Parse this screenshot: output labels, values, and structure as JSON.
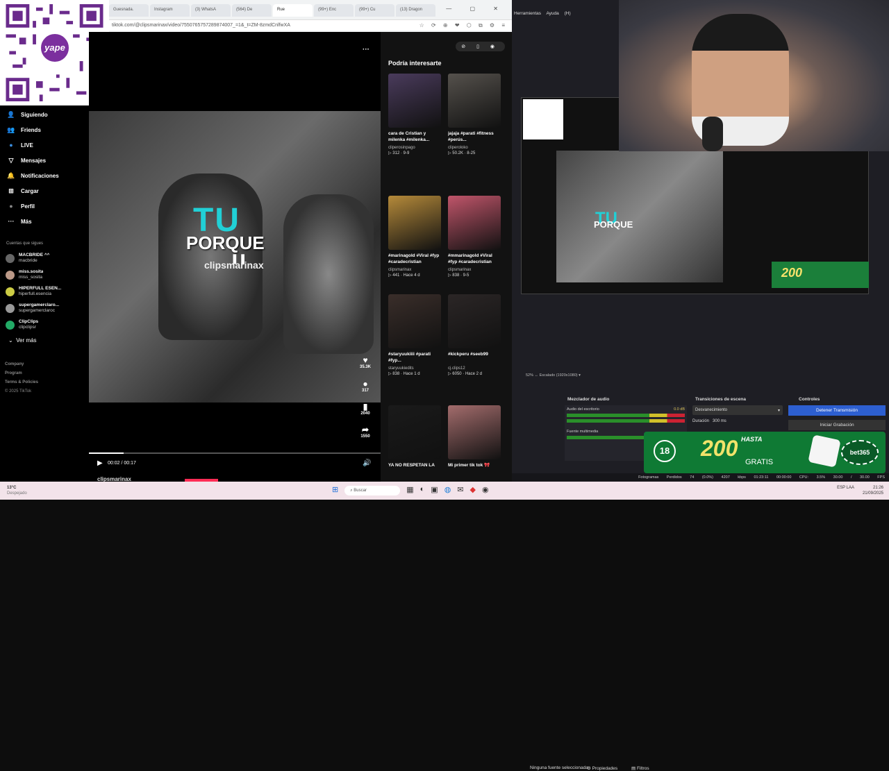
{
  "browser": {
    "tabs": [
      "Guesnada.",
      "Instagram",
      "(3) WhatsA",
      "(564) De",
      "Rue",
      "(99+) Enc",
      "(99+) Cu",
      "(13) Dragon"
    ],
    "url": "tiktok.com/@clipsmarinax/video/7550765757289874007_=1&_t=ZM-8zmdCnlfwXA",
    "window_controls": "— ▢ ✕",
    "addr_icons": "☆ ⟳ ⊕ ❤ ⬡ ⧉ ⚙ ≡"
  },
  "qr": {
    "badge": "yape"
  },
  "sidebar": {
    "items": [
      {
        "icon": "👤",
        "label": "Siguiendo"
      },
      {
        "icon": "👥",
        "label": "Friends"
      },
      {
        "icon": "●",
        "label": "LIVE"
      },
      {
        "icon": "▽",
        "label": "Mensajes"
      },
      {
        "icon": "🔔",
        "label": "Notificaciones"
      },
      {
        "icon": "⊞",
        "label": "Cargar"
      },
      {
        "icon": "●",
        "label": "Perfil"
      },
      {
        "icon": "···",
        "label": "Más"
      }
    ],
    "following_heading": "Cuentas que sigues",
    "accounts": [
      {
        "name": "MACBRIDE ^^",
        "handle": "macbride"
      },
      {
        "name": "miss.sosita",
        "handle": "miss_sosita"
      },
      {
        "name": "HIPERFULL ESEN...",
        "handle": "hiperfull.esencia"
      },
      {
        "name": "supergamerclaro...",
        "handle": "supergamerclaroc"
      },
      {
        "name": "ClipClips",
        "handle": "clipclipsr"
      }
    ],
    "see_more": "Ver más",
    "footer": [
      "Company",
      "Program",
      "Terms & Policies"
    ],
    "copyright": "© 2025 TikTok"
  },
  "video": {
    "caption_big": "TU",
    "caption_line": "PORQUE",
    "watermark": "clipsmarinax",
    "more": "···",
    "likes": "35.3K",
    "comments": "317",
    "saves": "2040",
    "shares": "1550",
    "time": "00:02 / 00:17",
    "progress": 0.12,
    "author": "clipsmarinax"
  },
  "recommendations": {
    "title": "Podría interesarte",
    "top_icons": "⊘ ▯ ◉",
    "cards": [
      {
        "title": "cara de Cristian y milenka #milenka...",
        "user": "cliperosinpago",
        "stats": "▷ 312 · 9-9",
        "color": "#4a3b5c"
      },
      {
        "title": "jajaja #parati #fitness #perús...",
        "user": "cliperoloko",
        "stats": "▷ 50.2K · 8-25",
        "color": "#55514c"
      },
      {
        "title": "#marinagold #Viral #fyp #caradecristian",
        "user": "clipsmarinax",
        "stats": "▷ 441 · Hace 4 d",
        "color": "#b58a3a"
      },
      {
        "title": "#mmarinagold #Viral #fyp #caradecristian",
        "user": "clipsmarinax",
        "stats": "▷ 838 · 9-5",
        "color": "#c0556a"
      },
      {
        "title": "#staryuukiiii #parati #fyp...",
        "user": "staryuukiedits",
        "stats": "▷ 838 · Hace 1 d",
        "color": "#3a2e2a"
      },
      {
        "title": "#kickperu #seeb99",
        "user": "cj.clips12",
        "stats": "▷ 6050 · Hace 2 d",
        "color": "#2b2626"
      },
      {
        "title": "YA NO RESPETAN LA",
        "user": "",
        "stats": "",
        "color": "#1a1a1a"
      },
      {
        "title": "Mi primer tik tok 🎀",
        "user": "",
        "stats": "",
        "color": "#a36c6c"
      }
    ]
  },
  "obs": {
    "menu": "Herramientas Ayuda (H)",
    "toolbar": "52%  ↔  Escalado (1920x1080)  ▾",
    "no_source": "Ninguna fuente seleccionada",
    "properties": "⚙ Propiedades",
    "filters": "▤ Filtros",
    "mixer_title": "Mezclador de audio",
    "mixer_ch1": "Audio del escritorio",
    "mixer_ch1_db": "0.0 dB",
    "mixer_ch2": "Fuente multimedia",
    "transitions_title": "Transiciones de escena",
    "transition": "Desvanecimiento",
    "duration_label": "Duración",
    "duration": "300 ms",
    "controls_title": "Controles",
    "stop_stream": "Detener Transmisión",
    "start_rec": "Iniciar Grabación",
    "status": "Fotogramas Perdidos 74 (0.0%)  4207 kbps  01:23:11  00:00:00  CPU: 3.5%  30.00 / 30.00 FPS"
  },
  "ad": {
    "age": "18",
    "hasta": "HASTA",
    "amount": "200",
    "gratis": "GRATIS",
    "brand": "bet365",
    "color": "#0f7a34"
  },
  "taskbar": {
    "weather_temp": "13°C",
    "weather_desc": "Despejado",
    "search": "Buscar",
    "icons": [
      "⊞",
      "⌕",
      "▦",
      "◐",
      "▣",
      "◍",
      "✉",
      "◆",
      "◉"
    ],
    "lang": "ESP LAA",
    "time": "21:26",
    "date": "21/09/2025"
  }
}
